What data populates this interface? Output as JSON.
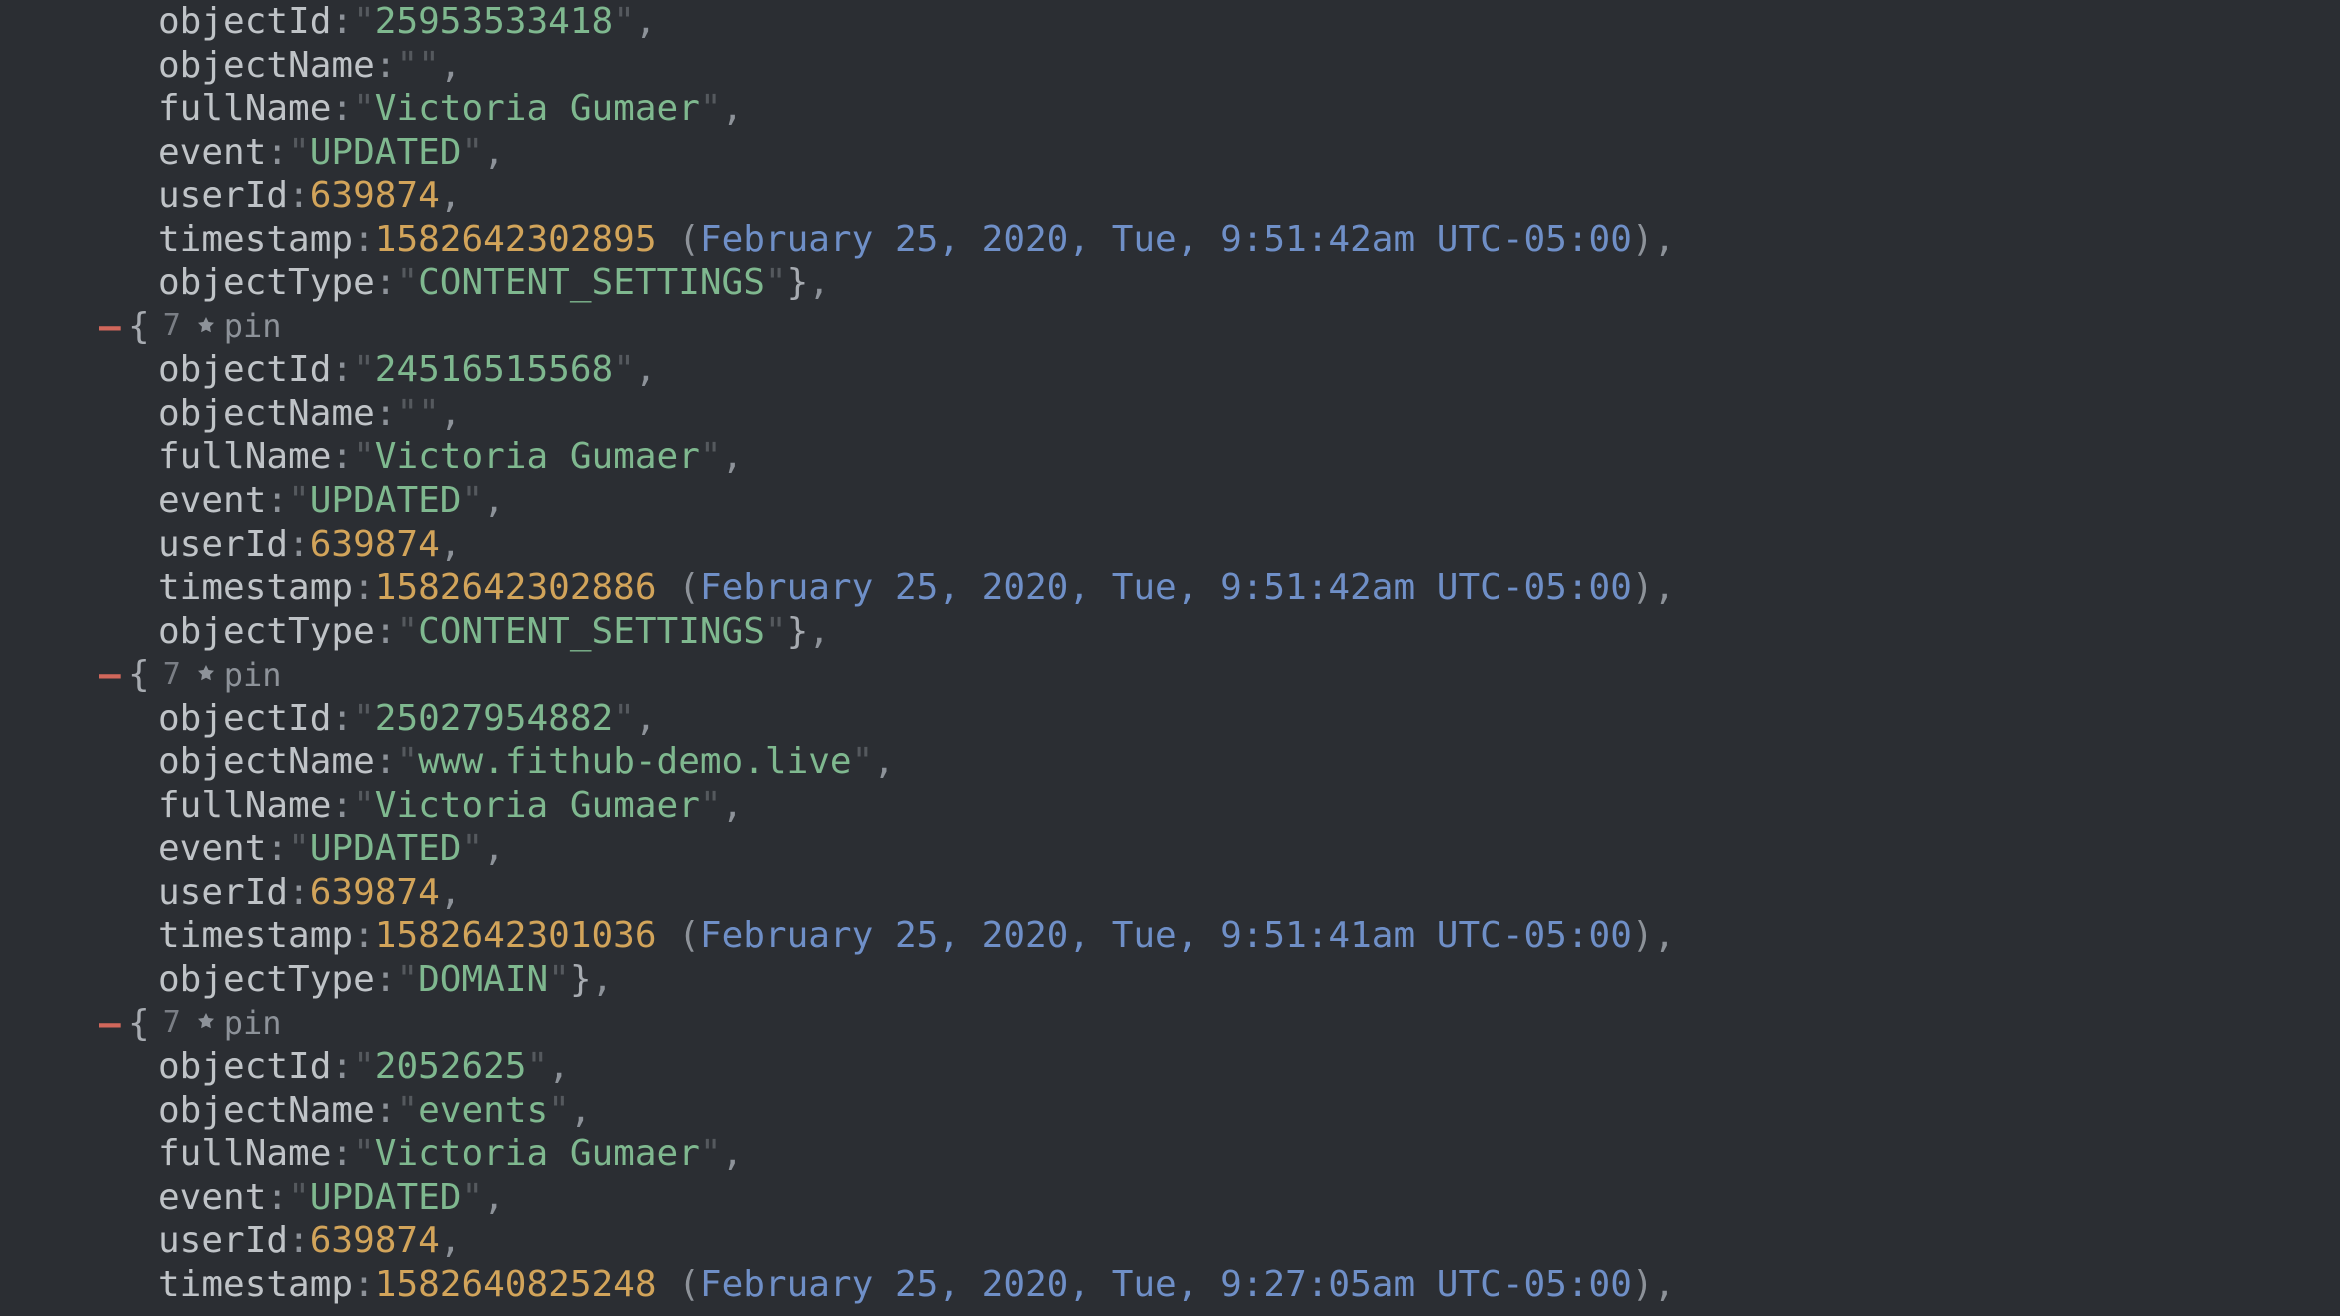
{
  "labels": {
    "objectId": "objectId",
    "objectName": "objectName",
    "fullName": "fullName",
    "event": "event",
    "userId": "userId",
    "timestamp": "timestamp",
    "objectType": "objectType",
    "pin": "pin",
    "collapse": "–",
    "count": "7"
  },
  "entries": [
    {
      "partial_head": true,
      "objectId": "25953533418",
      "objectName": "",
      "fullName": "Victoria Gumaer",
      "event": "UPDATED",
      "userId": "639874",
      "timestamp": "1582642302895",
      "timestamp_human": "February 25, 2020, Tue, 9:51:42am UTC-05:00",
      "objectType": "CONTENT_SETTINGS"
    },
    {
      "objectId": "24516515568",
      "objectName": "",
      "fullName": "Victoria Gumaer",
      "event": "UPDATED",
      "userId": "639874",
      "timestamp": "1582642302886",
      "timestamp_human": "February 25, 2020, Tue, 9:51:42am UTC-05:00",
      "objectType": "CONTENT_SETTINGS"
    },
    {
      "objectId": "25027954882",
      "objectName": "www.fithub-demo.live",
      "fullName": "Victoria Gumaer",
      "event": "UPDATED",
      "userId": "639874",
      "timestamp": "1582642301036",
      "timestamp_human": "February 25, 2020, Tue, 9:51:41am UTC-05:00",
      "objectType": "DOMAIN"
    },
    {
      "partial_tail": true,
      "objectId": "2052625",
      "objectName": "events",
      "fullName": "Victoria Gumaer",
      "event": "UPDATED",
      "userId": "639874",
      "timestamp": "1582640825248",
      "timestamp_human": "February 25, 2020, Tue, 9:27:05am UTC-05:00",
      "objectType": ""
    }
  ]
}
